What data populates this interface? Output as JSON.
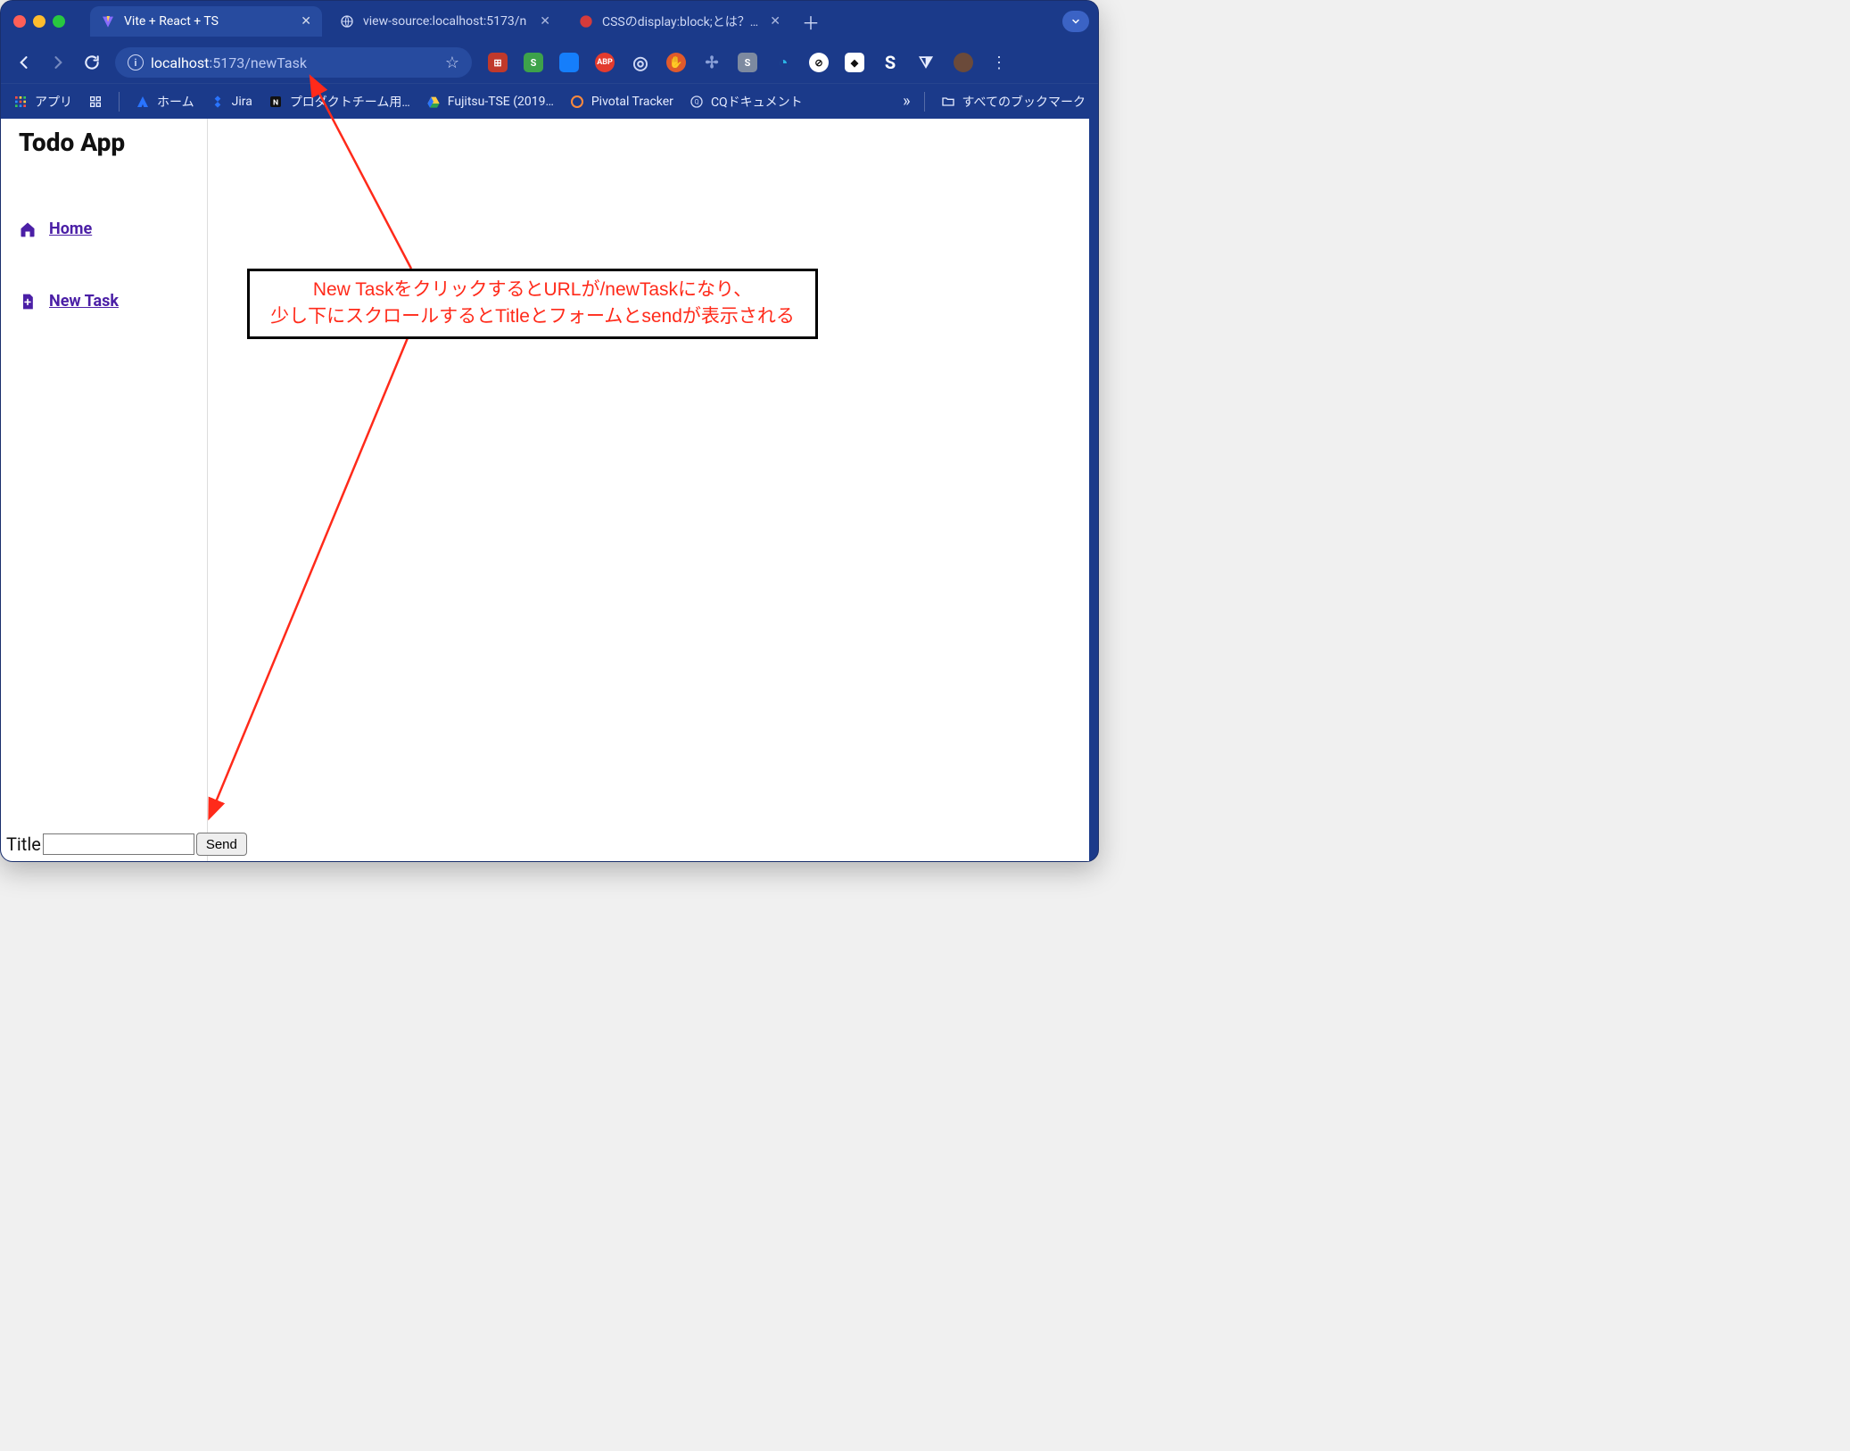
{
  "tabs": [
    {
      "title": "Vite + React + TS",
      "active": true
    },
    {
      "title": "view-source:localhost:5173/n",
      "active": false
    },
    {
      "title": "CSSのdisplay:block;とは？ブロ",
      "active": false
    }
  ],
  "url": {
    "host": "localhost",
    "rest": ":5173/newTask"
  },
  "bookmarks": {
    "apps": "アプリ",
    "items": [
      {
        "label": "ホーム"
      },
      {
        "label": "Jira"
      },
      {
        "label": "プロダクトチーム用…"
      },
      {
        "label": "Fujitsu-TSE (2019…"
      },
      {
        "label": "Pivotal Tracker"
      },
      {
        "label": "CQドキュメント"
      }
    ],
    "all": "すべてのブックマーク"
  },
  "page": {
    "app_title": "Todo App",
    "home": "Home",
    "new_task": "New Task",
    "form_label": "Title",
    "send": "Send"
  },
  "annotation": {
    "line1": "New TaskをクリックするとURLが/newTaskになり、",
    "line2": "少し下にスクロールするとTitleとフォームとsendが表示される"
  }
}
